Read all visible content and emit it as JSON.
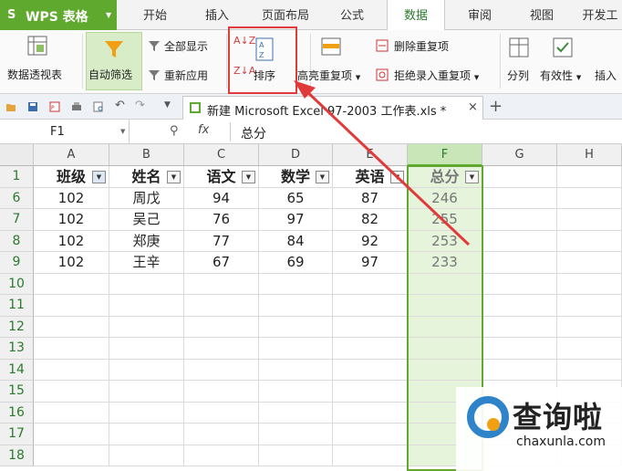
{
  "app": {
    "logo": "S",
    "name": "WPS 表格"
  },
  "tabs": [
    {
      "label": "开始"
    },
    {
      "label": "插入"
    },
    {
      "label": "页面布局"
    },
    {
      "label": "公式"
    },
    {
      "label": "数据",
      "active": true
    },
    {
      "label": "审阅"
    },
    {
      "label": "视图"
    },
    {
      "label": "开发工"
    }
  ],
  "ribbon": {
    "pivot": "数据透视表",
    "autofilter": "自动筛选",
    "show_all": "全部显示",
    "reapply": "重新应用",
    "sort": "排序",
    "highlight_dup": "高亮重复项",
    "remove_dup": "删除重复项",
    "reject_dup": "拒绝录入重复项",
    "split": "分列",
    "validity": "有效性",
    "insert": "插入"
  },
  "document": {
    "tab_title": "新建 Microsoft Excel 97-2003 工作表.xls *",
    "close": "×",
    "new_tab": "+"
  },
  "formula_bar": {
    "name_box": "F1",
    "fx": "fx",
    "value": "总分"
  },
  "sheet": {
    "columns": [
      "A",
      "B",
      "C",
      "D",
      "E",
      "F",
      "G",
      "H"
    ],
    "selected_column": "F",
    "headers": [
      "班级",
      "姓名",
      "语文",
      "数学",
      "英语",
      "总分"
    ],
    "row_numbers": [
      "1",
      "6",
      "7",
      "8",
      "9",
      "10",
      "11",
      "12",
      "13",
      "14",
      "15",
      "16",
      "17",
      "18"
    ],
    "rows": [
      [
        "102",
        "周戊",
        "94",
        "65",
        "87",
        "246"
      ],
      [
        "102",
        "吴己",
        "76",
        "97",
        "82",
        "255"
      ],
      [
        "102",
        "郑庚",
        "77",
        "84",
        "92",
        "253"
      ],
      [
        "102",
        "王辛",
        "67",
        "69",
        "97",
        "233"
      ]
    ]
  },
  "watermark": {
    "title": "查询啦",
    "domain": "chaxunla.com"
  },
  "colors": {
    "accent": "#5fa92e",
    "highlight": "#e03a3a",
    "selection_fill": "#e6f4dc"
  }
}
